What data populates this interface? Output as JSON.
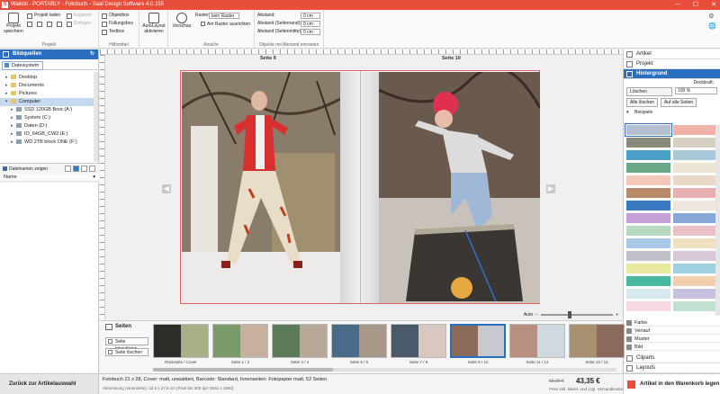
{
  "titlebar": {
    "logo": "S",
    "title": "Waikiki - PORTABLY - Fotobuch - Saal Design Software 4.0.155",
    "btn_min": "─",
    "btn_max": "☐",
    "btn_close": "✕"
  },
  "ribbon": {
    "project": {
      "save": "Projekt speichern",
      "load": "Projekt laden",
      "copy": "Kopieren",
      "paste": "Einfügen",
      "group": "Projekt"
    },
    "helpers": {
      "object_box": "Objektbox",
      "fill_box": "Füllungsbox",
      "text_box": "Textbox",
      "group": "Hilfsmittel"
    },
    "autolayout": {
      "label": "AutoLayout aktivieren"
    },
    "view": {
      "preview": "Vorschau",
      "grid_label": "Raster",
      "grid_value": "kein Raster",
      "align_grid": "Am Raster ausrichten",
      "group": "Ansicht"
    },
    "spacing": {
      "gap": "Abstand:",
      "gap_edge": "Abstand (Seitenrand):",
      "gap_page": "Abstand (Seitenmitte):",
      "value1": "0 cm",
      "value2": "0 cm",
      "value3": "0 cm",
      "group": "Objekte mit Abstand einrasten"
    }
  },
  "left": {
    "header": "Bildquellen",
    "tab": "Dateisystem",
    "tree": [
      {
        "label": "Desktop",
        "type": "folder"
      },
      {
        "label": "Documents",
        "type": "folder"
      },
      {
        "label": "Pictures",
        "type": "folder"
      },
      {
        "label": "Computer",
        "type": "computer"
      },
      {
        "label": "SSD 120GB Boot (A:)",
        "type": "drive"
      },
      {
        "label": "System (C:)",
        "type": "drive"
      },
      {
        "label": "Daten (D:)",
        "type": "drive"
      },
      {
        "label": "IO_64GB_CW2 (E:)",
        "type": "drive"
      },
      {
        "label": "WD 2TB block ONE (F:)",
        "type": "drive"
      }
    ],
    "show_filenames": "Dateinamen zeigen",
    "name_col": "Name"
  },
  "canvas": {
    "page_left": "Seite 9",
    "page_right": "Seite 10",
    "zoom": "Auto"
  },
  "right": {
    "items": [
      "Artikel",
      "Projekt",
      "Hintergrund"
    ],
    "opacity_label": "Deckkraft:",
    "delete": "Löschen",
    "opacity_value": "100 %",
    "all_delete": "Alle löschen",
    "all_pages": "Auf alle Seiten",
    "examples": "Beispiele",
    "sub": [
      "Farbe",
      "Verlauf",
      "Muster",
      "Bild"
    ],
    "bottom": [
      "Cliparts",
      "Layouts"
    ],
    "swatch_colors": [
      "#b4c0d0",
      "#f0b2a8",
      "#8a8a7a",
      "#d6d0c2",
      "#4aa0c8",
      "#a8c8d8",
      "#6aa888",
      "#ece6d4",
      "#f3c8b8",
      "#e8d8c8",
      "#b88a6a",
      "#e6b0b0",
      "#3a78c0",
      "#f0e6e0",
      "#c8a0d8",
      "#88a8d8",
      "#b8d8c0",
      "#e8c0c8",
      "#a8c8e8",
      "#f0e0c0",
      "#c0c0c8",
      "#d8c8d8",
      "#e8e8a0",
      "#a0d0e0",
      "#48b8a0",
      "#f0d0b0",
      "#d8e8f0",
      "#c8c0e0",
      "#f8d8e0",
      "#c0e0d0"
    ]
  },
  "pages": {
    "title": "Seiten",
    "add": "Seite hinzufügen",
    "remove": "Seite löschen",
    "thumbs": [
      {
        "label": "Rückseite / Cover",
        "c1": "#2c2c28",
        "c2": "#a8b088"
      },
      {
        "label": "Seite 1 / 2",
        "c1": "#7a9a6a",
        "c2": "#c8b0a0"
      },
      {
        "label": "Seite 3 / 4",
        "c1": "#5a7a5a",
        "c2": "#b8a898"
      },
      {
        "label": "Seite 5 / 6",
        "c1": "#4a6a8a",
        "c2": "#a89888"
      },
      {
        "label": "Seite 7 / 8",
        "c1": "#4a5a6a",
        "c2": "#d8c8c0"
      },
      {
        "label": "Seite 9 / 10",
        "c1": "#8a6a58",
        "c2": "#c8c8d0"
      },
      {
        "label": "Seite 11 / 12",
        "c1": "#b89080",
        "c2": "#d0d8e0"
      },
      {
        "label": "Seite 13 / 14",
        "c1": "#a89070",
        "c2": "#8a6a5a"
      }
    ]
  },
  "bottom": {
    "back": "Zurück zur Artikelauswahl",
    "info1": "Fotobuch 21 x 28, Cover: matt, unwattiert, Barcode: Standard, Innenseiten: Fotopapier matt, 52 Seiten",
    "info2": "Abmessung (Innenseite): 42,6 x 27,6 cm (Pixel bei 300 dpi: 5031 x 3260)",
    "price_old": "53,00 €",
    "price": "43,35 €",
    "price_info": "Preis inkl. MwSt. und zzgl. Versandkosten",
    "cart": "Artikel in den Warenkorb legen"
  }
}
